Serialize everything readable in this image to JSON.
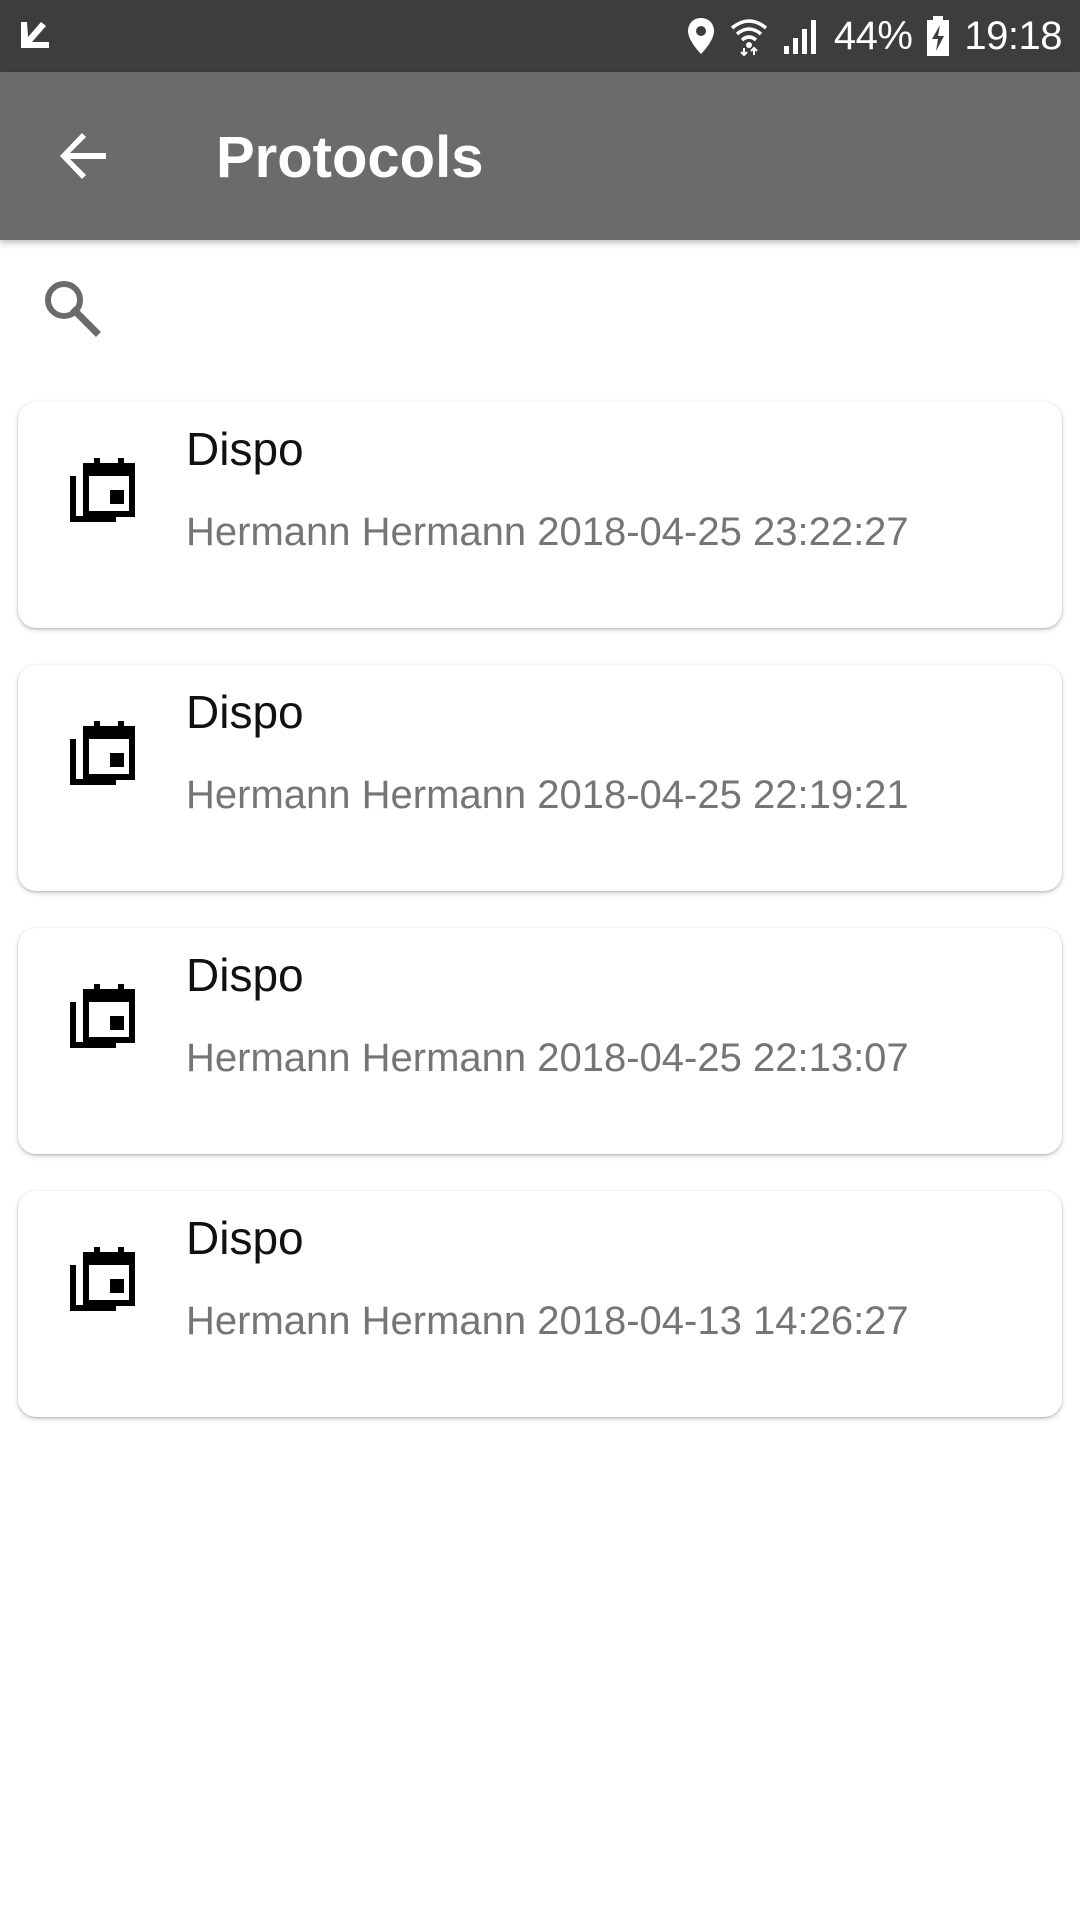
{
  "status_bar": {
    "battery": "44%",
    "time": "19:18",
    "icons": [
      "check-notification-icon",
      "location-icon",
      "wifi-icon",
      "signal-icon",
      "battery-charging-icon"
    ]
  },
  "app_bar": {
    "title": "Protocols",
    "background": "#6b6b6b",
    "back_icon": "arrow-back-icon"
  },
  "search": {
    "icon": "search-icon",
    "value": "",
    "placeholder": ""
  },
  "protocols": [
    {
      "title": "Dispo",
      "subtitle": "Hermann Hermann 2018-04-25 23:22:27",
      "icon": "calendar-stack-icon"
    },
    {
      "title": "Dispo",
      "subtitle": "Hermann Hermann 2018-04-25 22:19:21",
      "icon": "calendar-stack-icon"
    },
    {
      "title": "Dispo",
      "subtitle": "Hermann Hermann 2018-04-25 22:13:07",
      "icon": "calendar-stack-icon"
    },
    {
      "title": "Dispo",
      "subtitle": "Hermann Hermann 2018-04-13 14:26:27",
      "icon": "calendar-stack-icon"
    }
  ]
}
